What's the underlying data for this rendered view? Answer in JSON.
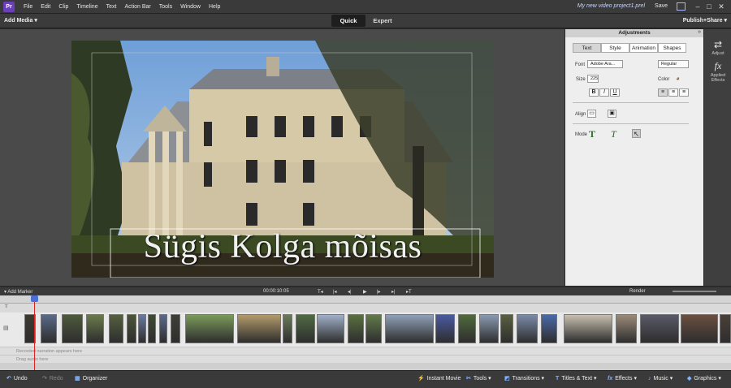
{
  "menu": {
    "logo": "Pr",
    "items": [
      "File",
      "Edit",
      "Clip",
      "Timeline",
      "Text",
      "Action Bar",
      "Tools",
      "Window",
      "Help"
    ],
    "project_name": "My new video project1.prel",
    "save": "Save",
    "window_controls": [
      "–",
      "□",
      "✕"
    ]
  },
  "toolbar": {
    "add_media": "Add Media ▾",
    "modes": [
      "Quick",
      "Expert"
    ],
    "active_mode": "Quick",
    "publish": "Publish+Share ▾"
  },
  "monitor": {
    "title_text": "Sügis Kolga mõisas"
  },
  "adjustments": {
    "title": "Adjustments",
    "collapse": "»",
    "tabs": [
      "Text",
      "Style",
      "Animation",
      "Shapes"
    ],
    "active_tab": "Text",
    "font_label": "Font",
    "font_value": "Adobe Ara...",
    "font_style": "Regular",
    "size_label": "Size",
    "size_value": "225",
    "color_label": "Color",
    "format_buttons": [
      "B",
      "I",
      "U"
    ],
    "align_label": "Align",
    "mode_label": "Mode",
    "mode_buttons": [
      "T",
      "T",
      "↖"
    ]
  },
  "sidebar": {
    "items": [
      {
        "icon": "⇄",
        "label": "Adjust"
      },
      {
        "icon": "fx",
        "label": "Applied Effects"
      }
    ]
  },
  "timeline": {
    "add_marker": "▾ Add Marker",
    "timecode": "00:00:10:05",
    "transport": [
      "T◂",
      "|◂",
      "◂|",
      "▶",
      "|▸",
      "▸|",
      "▸T"
    ],
    "render": "Render",
    "narration_placeholder": "Recorded narration appears here",
    "audio_placeholder": "Drag audio here"
  },
  "actionbar": {
    "undo": "Undo",
    "redo": "Redo",
    "organizer": "Organizer",
    "instant_movie": "Instant Movie",
    "tools": "Tools ▾",
    "transitions": "Transitions ▾",
    "titles_text": "Titles & Text ▾",
    "effects": "Effects ▾",
    "music": "Music ▾",
    "graphics": "Graphics ▾"
  },
  "colors": {
    "accent": "#6a3fb8",
    "playhead": "#d22222",
    "bar_bg": "#3a3a3a"
  }
}
